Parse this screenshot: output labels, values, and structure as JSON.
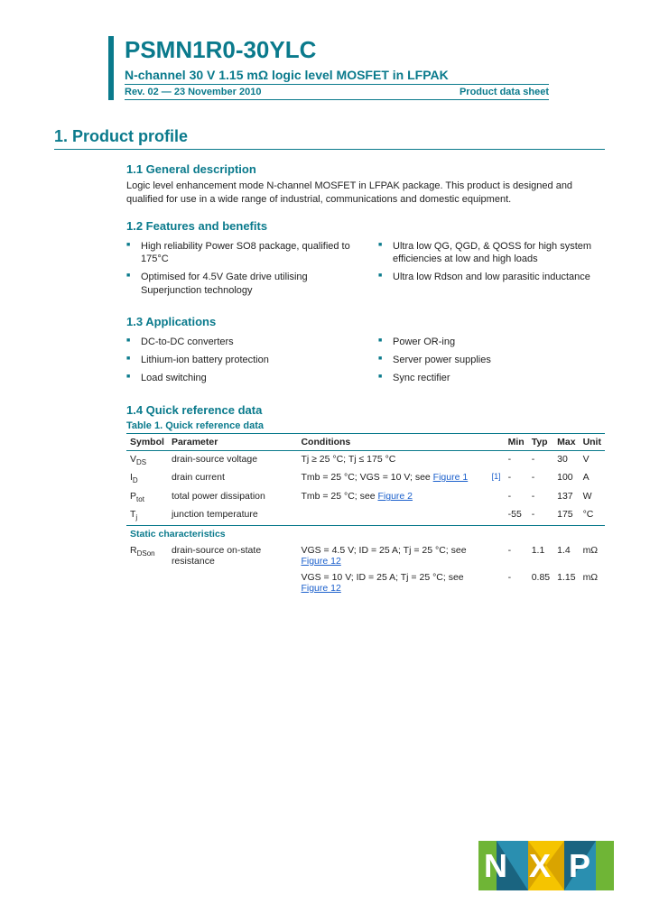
{
  "header": {
    "part_number": "PSMN1R0-30YLC",
    "subtitle": "N-channel 30 V 1.15 mΩ logic level MOSFET in LFPAK",
    "revision": "Rev. 02 — 23 November 2010",
    "doc_type": "Product data sheet"
  },
  "section1": {
    "number_title": "1.   Product profile",
    "s1": {
      "title": "1.1   General description",
      "text": "Logic level enhancement mode N-channel MOSFET in LFPAK package. This product is designed and qualified for use in a wide range of industrial, communications and domestic equipment."
    },
    "s2": {
      "title": "1.2   Features and benefits",
      "left": [
        "High reliability Power SO8 package, qualified to 175°C",
        "Optimised for 4.5V Gate drive utilising Superjunction technology"
      ],
      "right": [
        "Ultra low QG, QGD, & QOSS for high system efficiencies at low and high loads",
        "Ultra low Rdson and low parasitic inductance"
      ]
    },
    "s3": {
      "title": "1.3   Applications",
      "left": [
        "DC-to-DC converters",
        "Lithium-ion battery protection",
        "Load switching"
      ],
      "right": [
        "Power OR-ing",
        "Server power supplies",
        "Sync rectifier"
      ]
    },
    "s4": {
      "title": "1.4   Quick reference data",
      "table_label": "Table 1.    Quick reference data",
      "headers": [
        "Symbol",
        "Parameter",
        "Conditions",
        "",
        "Min",
        "Typ",
        "Max",
        "Unit"
      ],
      "rows": [
        {
          "sym": "V",
          "sub": "DS",
          "param": "drain-source voltage",
          "cond": "Tj ≥ 25 °C; Tj ≤ 175 °C",
          "note": "",
          "min": "-",
          "typ": "-",
          "max": "30",
          "unit": "V"
        },
        {
          "sym": "I",
          "sub": "D",
          "param": "drain current",
          "cond": "Tmb = 25 °C; VGS = 10 V; see ",
          "link": "Figure 1",
          "note": "[1]",
          "min": "-",
          "typ": "-",
          "max": "100",
          "unit": "A"
        },
        {
          "sym": "P",
          "sub": "tot",
          "param": "total power dissipation",
          "cond": "Tmb = 25 °C; see ",
          "link": "Figure 2",
          "note": "",
          "min": "-",
          "typ": "-",
          "max": "137",
          "unit": "W"
        },
        {
          "sym": "T",
          "sub": "j",
          "param": "junction temperature",
          "cond": "",
          "note": "",
          "min": "-55",
          "typ": "-",
          "max": "175",
          "unit": "°C"
        }
      ],
      "static_label": "Static characteristics",
      "static_rows": [
        {
          "sym": "R",
          "sub": "DSon",
          "param": "drain-source on-state resistance",
          "cond": "VGS = 4.5 V; ID = 25 A; Tj = 25 °C; see ",
          "link": "Figure 12",
          "min": "-",
          "typ": "1.1",
          "max": "1.4",
          "unit": "mΩ"
        },
        {
          "sym": "",
          "sub": "",
          "param": "",
          "cond": "VGS = 10 V; ID = 25 A; Tj = 25 °C; see ",
          "link": "Figure 12",
          "min": "-",
          "typ": "0.85",
          "max": "1.15",
          "unit": "mΩ"
        }
      ]
    }
  }
}
